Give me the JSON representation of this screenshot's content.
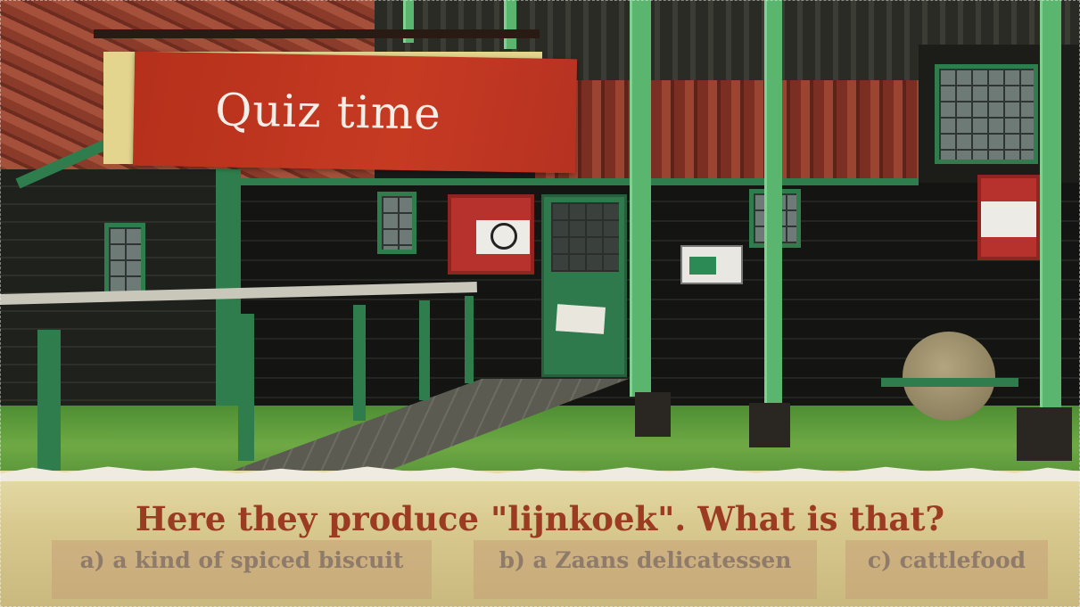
{
  "quiz": {
    "title": "Quiz time",
    "question": "Here they produce \"lijnkoek\". What is that?",
    "answers": [
      {
        "label": "a) a kind of spiced biscuit"
      },
      {
        "label": "b) a Zaans delicatessen"
      },
      {
        "label": "c) cattlefood"
      }
    ]
  },
  "colors": {
    "banner": "#c63a22",
    "banner_backing": "#e3d48e",
    "question_text": "#9b3b22",
    "answer_text": "#8e7b6a",
    "paper": "#d8c98f"
  }
}
